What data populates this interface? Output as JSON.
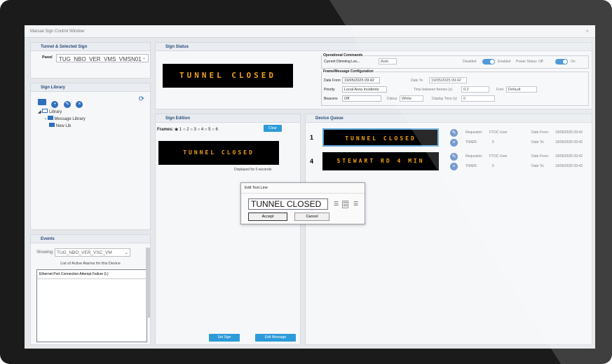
{
  "window": {
    "title": "Manual Sign Control Window",
    "close": "×"
  },
  "tunnel": {
    "header": "Tunnel & Selected Sign",
    "panel_label": "Panel",
    "panel_value": "TUG_NBO_VER_VMS_VMSN01"
  },
  "library": {
    "header": "Sign Library",
    "tree": [
      {
        "label": "Library"
      },
      {
        "label": "Message Library"
      },
      {
        "label": "New Lib"
      }
    ]
  },
  "events": {
    "header": "Events",
    "showing_label": "Showing:",
    "showing_value": "TUG_NBO_VER_VSC_VM",
    "list_title": "List of Active Alarms for this Device",
    "alarms": [
      "Ethernet Port Connection Attempt Failure (L)"
    ]
  },
  "status": {
    "header": "Sign Status",
    "display": "TUNNEL CLOSED",
    "op_legend": "Operational Commands",
    "dim_label": "Current Dimming Lev...",
    "dim_value": "Auto",
    "disabled": "Disabled",
    "enabled": "Enabled",
    "power_label": "Power Status",
    "off": "Off",
    "on": "On",
    "fm_legend": "Frame/Message Configuration",
    "date_from_label": "Date From",
    "date_from_value": "19/05/2025 09:42",
    "date_to_label": "Date To",
    "date_to_value": "19/05/2025 09:42",
    "priority_label": "Priority",
    "priority_value": "Local Area Incidents",
    "tbf_label": "Time between frames (s)",
    "tbf_value": "0.2",
    "font_label": "Font",
    "font_value": "Default",
    "beacons_label": "Beacons",
    "beacons_value": "Off",
    "colour_label": "Colour",
    "colour_value": "White",
    "display_time_label": "Display Time (s)",
    "display_time_value": "0"
  },
  "edition": {
    "header": "Sign Edition",
    "frames_label": "Frames:",
    "frames": [
      "1",
      "2",
      "3",
      "4",
      "5",
      "6"
    ],
    "clear": "Clear",
    "display": "TUNNEL CLOSED",
    "displayed_for": "Displayed for 0 seconds",
    "set_sign": "Set Sign",
    "edit_message": "Edit Message"
  },
  "queue": {
    "header": "Device Queue",
    "items": [
      {
        "priority": "1",
        "text": "TUNNEL CLOSED",
        "requestor_label": "Requestor:",
        "requestor": "FTOC User",
        "date_from_label": "Date From:",
        "date_from": "19/05/2025 09:42",
        "ttl_label": "TIMER:",
        "ttl": "0",
        "date_to_label": "Date To:",
        "date_to": "19/05/2025 09:42"
      },
      {
        "priority": "4",
        "text": "STEWART RD 4 MIN",
        "requestor_label": "Requestor:",
        "requestor": "FTOC User",
        "date_from_label": "Date From:",
        "date_from": "19/05/2025 09:42",
        "ttl_label": "TIMER:",
        "ttl": "0",
        "date_to_label": "Date To:",
        "date_to": "19/05/2025 09:42"
      }
    ]
  },
  "dialog": {
    "title": "Edit Text Line",
    "text": "TUNNEL CLOSED",
    "accept": "Accept",
    "cancel": "Cancel"
  }
}
